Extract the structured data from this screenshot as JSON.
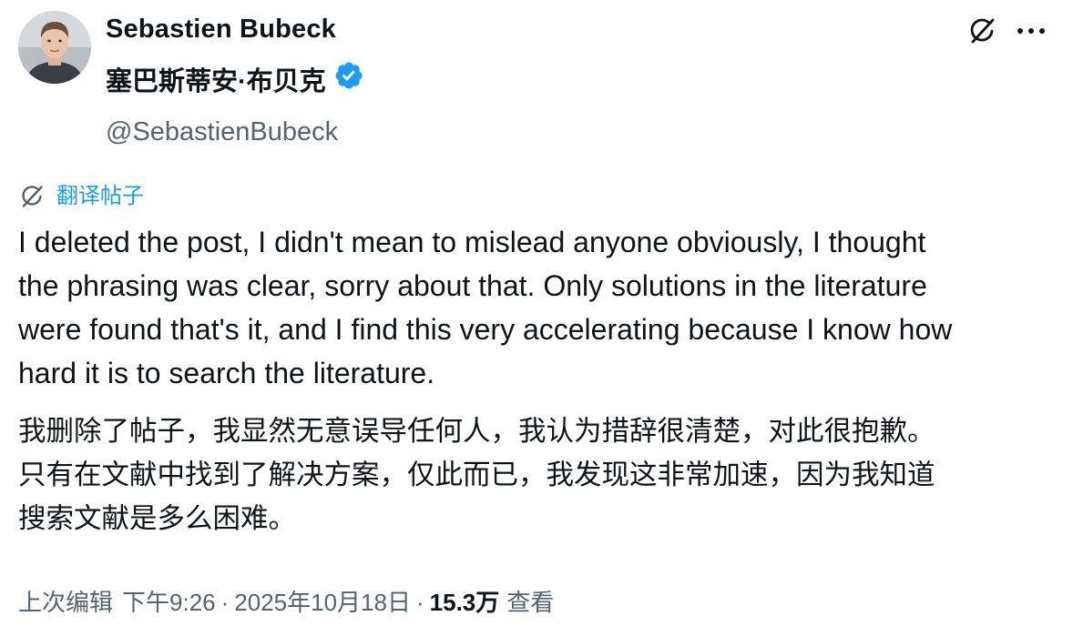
{
  "author": {
    "display_name": "Sebastien Bubeck",
    "display_name_cn": "塞巴斯蒂安·布贝克",
    "handle": "@SebastienBubeck",
    "verified": true,
    "verified_color": "#1d9bf0"
  },
  "header_actions": {
    "grok_icon": "grok-icon",
    "more_icon": "more-dots-icon"
  },
  "translate": {
    "icon": "grok-icon",
    "label": "翻译帖子",
    "color": "#1d9bf0"
  },
  "post": {
    "lines": [
      "I deleted the post, I didn't mean to mislead anyone obviously, I thought",
      "the phrasing was clear, sorry about that. Only solutions in the literature",
      "were found that's it, and I find this very accelerating because I know how",
      "hard it is to search the literature."
    ]
  },
  "translation": {
    "lines": [
      "我删除了帖子，我显然无意误导任何人，我认为措辞很清楚，对此很抱歉。",
      "只有在文献中找到了解决方案，仅此而已，我发现这非常加速，因为我知道",
      "搜索文献是多么困难。"
    ]
  },
  "meta": {
    "edited_label": "上次编辑",
    "time": "下午9:26",
    "separator": "·",
    "date": "2025年10月18日",
    "views_count": "15.3万",
    "views_label": "查看"
  }
}
